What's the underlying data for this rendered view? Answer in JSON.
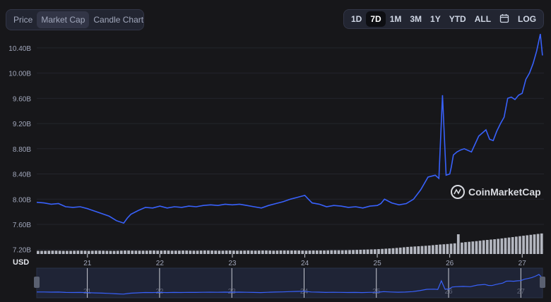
{
  "tabs": [
    "Price",
    "Market Cap",
    "Candle Chart"
  ],
  "active_tab": 1,
  "ranges": [
    "1D",
    "7D",
    "1M",
    "3M",
    "1Y",
    "YTD",
    "ALL"
  ],
  "active_range": 1,
  "log_label": "LOG",
  "calendar_icon": "calendar-icon",
  "currency_label": "USD",
  "watermark": "CoinMarketCap",
  "colors": {
    "line": "#3861fb",
    "bg": "#17171a",
    "grid": "#23252c",
    "volume": "#b4b7c0"
  },
  "chart_data": {
    "type": "line",
    "title": "",
    "xlabel": "",
    "ylabel": "",
    "y_tick_labels": [
      "10.40B",
      "10.00B",
      "9.60B",
      "9.20B",
      "8.80B",
      "8.40B",
      "8.00B",
      "7.60B",
      "7.20B"
    ],
    "y_ticks": [
      10.4,
      10.0,
      9.6,
      9.2,
      8.8,
      8.4,
      8.0,
      7.6,
      7.2
    ],
    "x_tick_labels": [
      "21",
      "22",
      "23",
      "24",
      "25",
      "26",
      "27"
    ],
    "x_ticks": [
      21,
      22,
      23,
      24,
      25,
      26,
      27
    ],
    "xlim": [
      20.3,
      27.3
    ],
    "ylim": [
      7.13,
      10.6
    ],
    "grid": true,
    "series": [
      {
        "x": [
          20.3,
          20.4,
          20.5,
          20.6,
          20.7,
          20.8,
          20.9,
          21.0,
          21.1,
          21.2,
          21.3,
          21.4,
          21.5,
          21.55,
          21.6,
          21.7,
          21.8,
          21.9,
          22.0,
          22.1,
          22.2,
          22.3,
          22.4,
          22.5,
          22.6,
          22.7,
          22.8,
          22.9,
          23.0,
          23.1,
          23.2,
          23.3,
          23.4,
          23.5,
          23.6,
          23.7,
          23.8,
          23.9,
          24.0,
          24.05,
          24.1,
          24.2,
          24.3,
          24.4,
          24.5,
          24.6,
          24.7,
          24.8,
          24.9,
          25.0,
          25.05,
          25.1,
          25.2,
          25.3,
          25.4,
          25.5,
          25.6,
          25.7,
          25.8,
          25.85,
          25.9,
          25.95,
          26.0,
          26.01,
          26.02,
          26.05,
          26.1,
          26.15,
          26.2,
          26.3,
          26.4,
          26.5,
          26.55,
          26.6,
          26.65,
          26.7,
          26.75,
          26.8,
          26.85,
          26.9,
          26.95,
          27.0,
          27.05,
          27.1,
          27.15,
          27.2,
          27.25,
          27.28
        ],
        "y": [
          7.95,
          7.94,
          7.92,
          7.93,
          7.88,
          7.87,
          7.88,
          7.85,
          7.81,
          7.77,
          7.73,
          7.66,
          7.62,
          7.7,
          7.76,
          7.82,
          7.87,
          7.86,
          7.89,
          7.86,
          7.88,
          7.87,
          7.89,
          7.88,
          7.9,
          7.91,
          7.9,
          7.92,
          7.91,
          7.92,
          7.9,
          7.88,
          7.86,
          7.9,
          7.93,
          7.96,
          8.0,
          8.03,
          8.06,
          8.0,
          7.94,
          7.92,
          7.88,
          7.9,
          7.89,
          7.87,
          7.88,
          7.86,
          7.89,
          7.9,
          7.93,
          8.0,
          7.94,
          7.91,
          7.93,
          8.0,
          8.15,
          8.35,
          8.38,
          8.33,
          9.65,
          8.38,
          8.4,
          8.45,
          8.5,
          8.7,
          8.75,
          8.78,
          8.8,
          8.75,
          9.0,
          9.1,
          8.95,
          8.93,
          9.08,
          9.2,
          9.3,
          9.6,
          9.62,
          9.58,
          9.65,
          9.68,
          9.9,
          10.0,
          10.15,
          10.35,
          10.62,
          10.28
        ],
        "volume": [
          0.16,
          0.16,
          0.17,
          0.17,
          0.16,
          0.16,
          0.17,
          0.17,
          0.16,
          0.17,
          0.17,
          0.16,
          0.16,
          0.17,
          0.18,
          0.17,
          0.17,
          0.17,
          0.18,
          0.17,
          0.18,
          0.17,
          0.17,
          0.18,
          0.17,
          0.17,
          0.18,
          0.18,
          0.17,
          0.17,
          0.18,
          0.17,
          0.17,
          0.18,
          0.17,
          0.18,
          0.18,
          0.17,
          0.18,
          0.18,
          0.18,
          0.18,
          0.17,
          0.18,
          0.18,
          0.18,
          0.19,
          0.19,
          0.19,
          0.2,
          0.21,
          0.22,
          0.23,
          0.24,
          0.26,
          0.28,
          0.3,
          0.33,
          0.36,
          0.38,
          0.4,
          0.42,
          0.45,
          0.48,
          0.5,
          0.53,
          0.56,
          0.6,
          0.63,
          0.66,
          0.7,
          0.73,
          0.76,
          0.8,
          0.84,
          0.88,
          0.92,
          0.96,
          1.0,
          1.04
        ]
      }
    ]
  }
}
